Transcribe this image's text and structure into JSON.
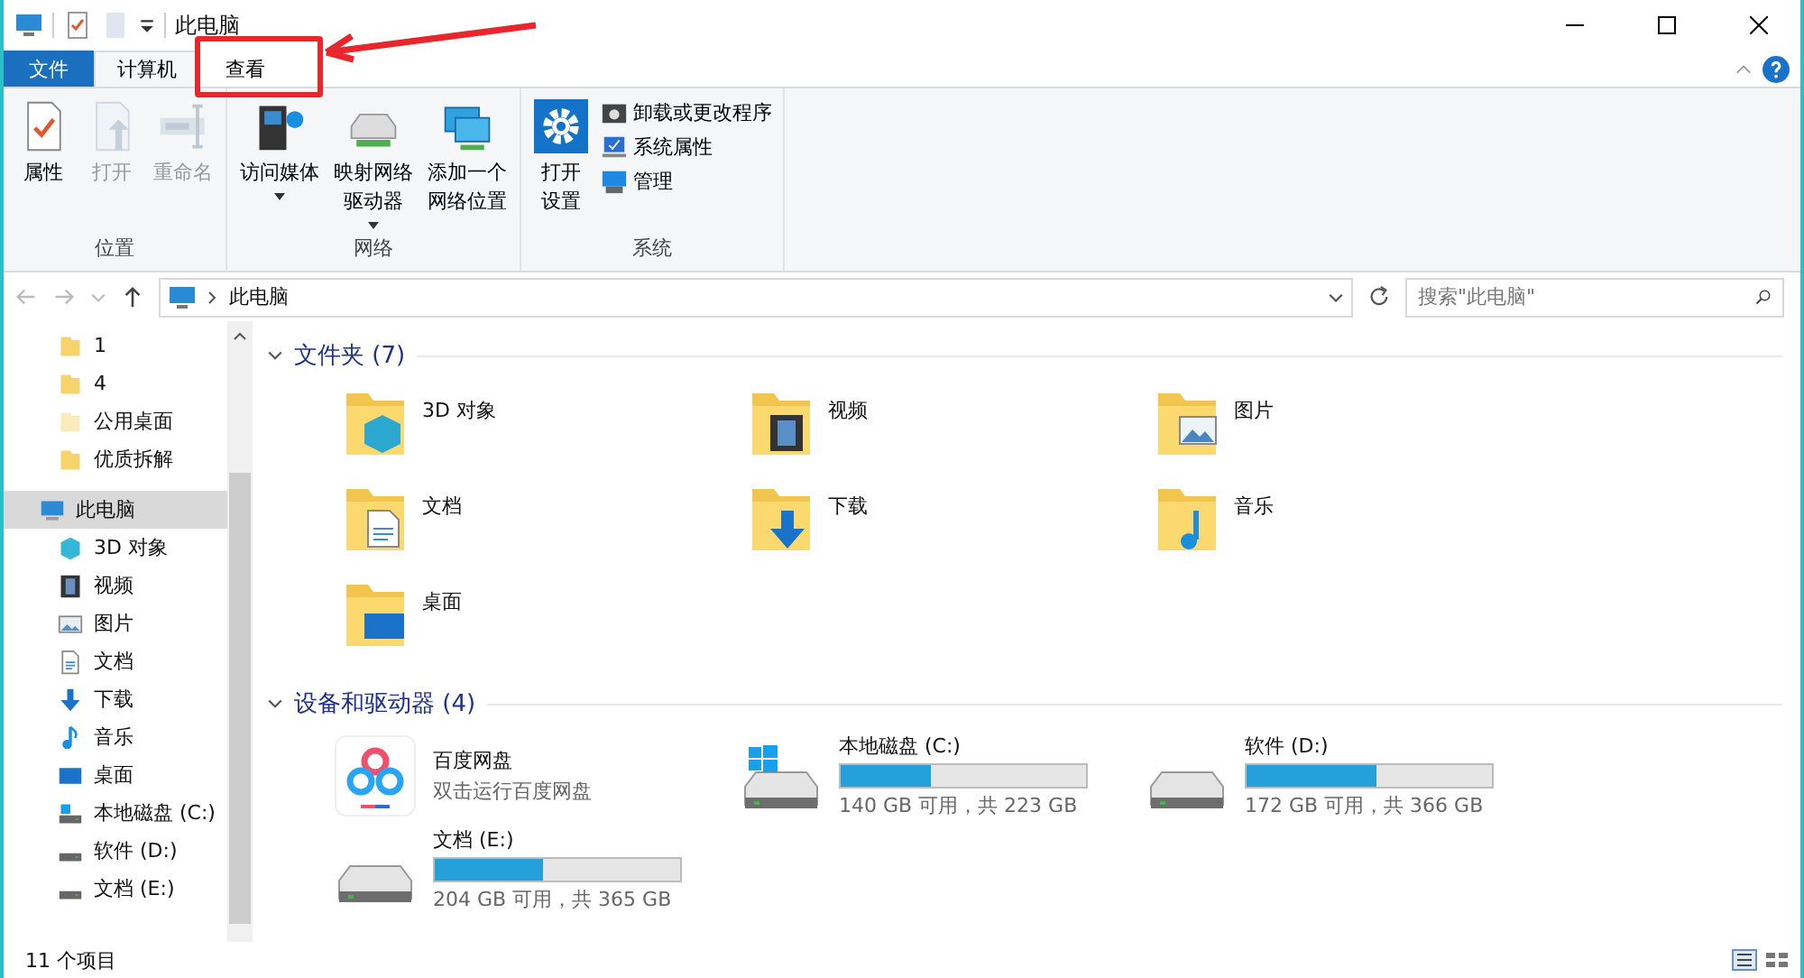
{
  "window": {
    "title": "此电脑"
  },
  "tabs": [
    {
      "label": "文件",
      "kind": "file",
      "selected": false,
      "highlighted": false
    },
    {
      "label": "计算机",
      "kind": "tab",
      "selected": true,
      "highlighted": false
    },
    {
      "label": "查看",
      "kind": "tab",
      "selected": false,
      "highlighted": true
    }
  ],
  "ribbon": [
    {
      "label": "位置",
      "items": [
        {
          "kind": "properties",
          "lines": [
            "属性"
          ],
          "disabled": false,
          "dropdown": false
        },
        {
          "kind": "open",
          "lines": [
            "打开"
          ],
          "disabled": true,
          "dropdown": false
        },
        {
          "kind": "rename",
          "lines": [
            "重命名"
          ],
          "disabled": true,
          "dropdown": false
        }
      ]
    },
    {
      "label": "网络",
      "items": [
        {
          "kind": "media",
          "lines": [
            "访问媒体"
          ],
          "disabled": false,
          "dropdown": true
        },
        {
          "kind": "drive",
          "lines": [
            "映射网络",
            "驱动器"
          ],
          "disabled": false,
          "dropdown": true
        },
        {
          "kind": "location",
          "lines": [
            "添加一个",
            "网络位置"
          ],
          "disabled": false,
          "dropdown": false
        }
      ]
    },
    {
      "label": "系统",
      "items": [
        {
          "kind": "settings",
          "lines": [
            "打开",
            "设置"
          ],
          "disabled": false,
          "dropdown": false
        }
      ],
      "small_items": [
        {
          "kind": "uninstall",
          "label": "卸载或更改程序"
        },
        {
          "kind": "sysprops",
          "label": "系统属性"
        },
        {
          "kind": "manage",
          "label": "管理"
        }
      ]
    }
  ],
  "address": {
    "path": "此电脑"
  },
  "search": {
    "placeholder": "搜索\"此电脑\""
  },
  "sidebar": {
    "items": [
      {
        "label": "1",
        "kind": "folder",
        "selected": false
      },
      {
        "label": "4",
        "kind": "folder",
        "selected": false
      },
      {
        "label": "公用桌面",
        "kind": "faded",
        "selected": false
      },
      {
        "label": "优质拆解",
        "kind": "folder",
        "selected": false
      },
      {
        "label": "此电脑",
        "kind": "pc",
        "selected": true
      },
      {
        "label": "3D 对象",
        "kind": "cube",
        "selected": false
      },
      {
        "label": "视频",
        "kind": "video",
        "selected": false
      },
      {
        "label": "图片",
        "kind": "picture",
        "selected": false
      },
      {
        "label": "文档",
        "kind": "doc",
        "selected": false
      },
      {
        "label": "下载",
        "kind": "download",
        "selected": false
      },
      {
        "label": "音乐",
        "kind": "music",
        "selected": false
      },
      {
        "label": "桌面",
        "kind": "desktop",
        "selected": false
      },
      {
        "label": "本地磁盘 (C:)",
        "kind": "sysdrive",
        "selected": false
      },
      {
        "label": "软件 (D:)",
        "kind": "drive",
        "selected": false
      },
      {
        "label": "文档 (E:)",
        "kind": "drive",
        "selected": false
      }
    ]
  },
  "folders": {
    "title": "文件夹 (7)",
    "items": [
      {
        "label": "3D 对象",
        "kind": "cube"
      },
      {
        "label": "视频",
        "kind": "video"
      },
      {
        "label": "图片",
        "kind": "picture"
      },
      {
        "label": "文档",
        "kind": "doc"
      },
      {
        "label": "下载",
        "kind": "download"
      },
      {
        "label": "音乐",
        "kind": "music"
      },
      {
        "label": "桌面",
        "kind": "desktop"
      }
    ]
  },
  "drives": {
    "title": "设备和驱动器 (4)",
    "items": [
      {
        "label": "百度网盘",
        "kind": "app",
        "detail": "双击运行百度网盘"
      },
      {
        "label": "本地磁盘 (C:)",
        "kind": "sysdrive",
        "level": 0.37,
        "detail": "140 GB 可用，共 223 GB"
      },
      {
        "label": "软件 (D:)",
        "kind": "drive",
        "level": 0.53,
        "detail": "172 GB 可用，共 366 GB"
      },
      {
        "label": "文档 (E:)",
        "kind": "drive",
        "level": 0.44,
        "detail": "204 GB 可用，共 365 GB"
      }
    ]
  },
  "status_bar": {
    "count": "11 个项目"
  }
}
